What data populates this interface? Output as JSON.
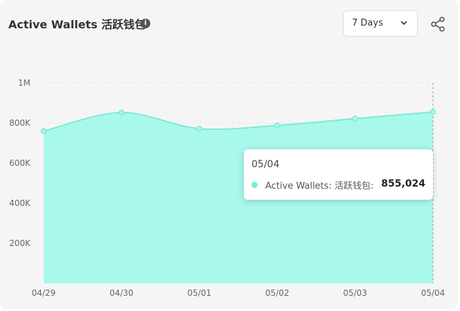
{
  "header": {
    "title": "Active Wallets 活跃钱包",
    "info_icon_glyph": "i",
    "range_select": {
      "value": "7 Days"
    }
  },
  "icons": {
    "info": "info-icon",
    "dropdown": "chevron-down-icon",
    "share": "share-icon"
  },
  "colors": {
    "area_fill": "#a8f8ec",
    "line": "#7fe9d4",
    "accent": "#7fe9d4"
  },
  "tooltip": {
    "date": "05/04",
    "series_label": "Active Wallets: 活跃钱包:",
    "value": "855,024"
  },
  "chart_data": {
    "type": "area",
    "x": [
      "04/29",
      "04/30",
      "05/01",
      "05/02",
      "05/03",
      "05/04"
    ],
    "series": [
      {
        "name": "Active Wallets: 活跃钱包",
        "values": [
          760000,
          852000,
          772000,
          788000,
          822000,
          855024
        ]
      }
    ],
    "y_ticks": [
      200000,
      400000,
      600000,
      800000,
      1000000
    ],
    "y_tick_labels": [
      "200K",
      "400K",
      "600K",
      "800K",
      "1M"
    ],
    "ylim": [
      0,
      1000000
    ],
    "grid": true,
    "highlighted_index": 5
  }
}
